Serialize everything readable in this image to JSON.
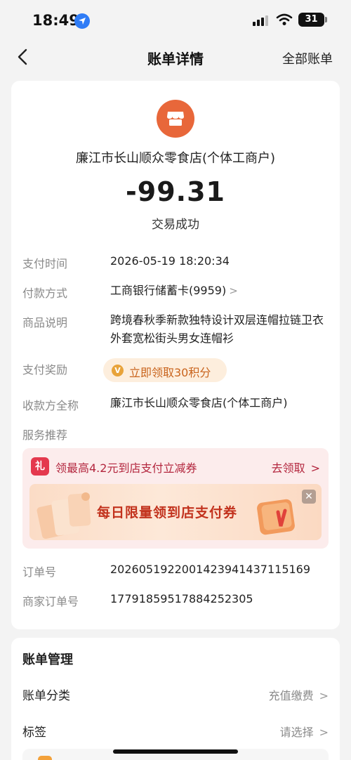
{
  "status_bar": {
    "time": "18:49",
    "battery": "31"
  },
  "nav": {
    "title": "账单详情",
    "right_link": "全部账单"
  },
  "transaction": {
    "merchant_name": "廉江市长山顺众零食店(个体工商户)",
    "amount": "-99.31",
    "status": "交易成功"
  },
  "details": {
    "pay_time_label": "支付时间",
    "pay_time_value": "2026-05-19 18:20:34",
    "pay_method_label": "付款方式",
    "pay_method_value": "工商银行储蓄卡(9959)",
    "goods_label": "商品说明",
    "goods_value": "跨境春秋季新款独特设计双层连帽拉链卫衣外套宽松街头男女连帽衫",
    "reward_label": "支付奖励",
    "reward_value": "立即领取30积分",
    "payee_label": "收款方全称",
    "payee_value": "廉江市长山顺众零食店(个体工商户)",
    "service_label": "服务推荐",
    "order_no_label": "订单号",
    "order_no_value": "2026051922001423941437115169",
    "merchant_order_label": "商家订单号",
    "merchant_order_value": "17791859517884252305"
  },
  "promo": {
    "gift_glyph": "礼",
    "title": "领最高4.2元到店支付立减券",
    "link": "去领取",
    "banner_text": "每日限量领到店支付券"
  },
  "manage": {
    "title": "账单管理",
    "category_label": "账单分类",
    "category_value": "充值缴费",
    "tag_label": "标签",
    "tag_value": "请选择"
  },
  "icons": {
    "back": "back-arrow-icon",
    "store": "store-icon",
    "location": "location-arrow-icon",
    "coin": "points-coin-icon",
    "gift": "gift-icon",
    "close": "close-icon"
  },
  "colors": {
    "store_logo": "#e8673a",
    "reward_text": "#c9641d",
    "promo_text": "#b3263e",
    "banner_text": "#c2321d"
  }
}
